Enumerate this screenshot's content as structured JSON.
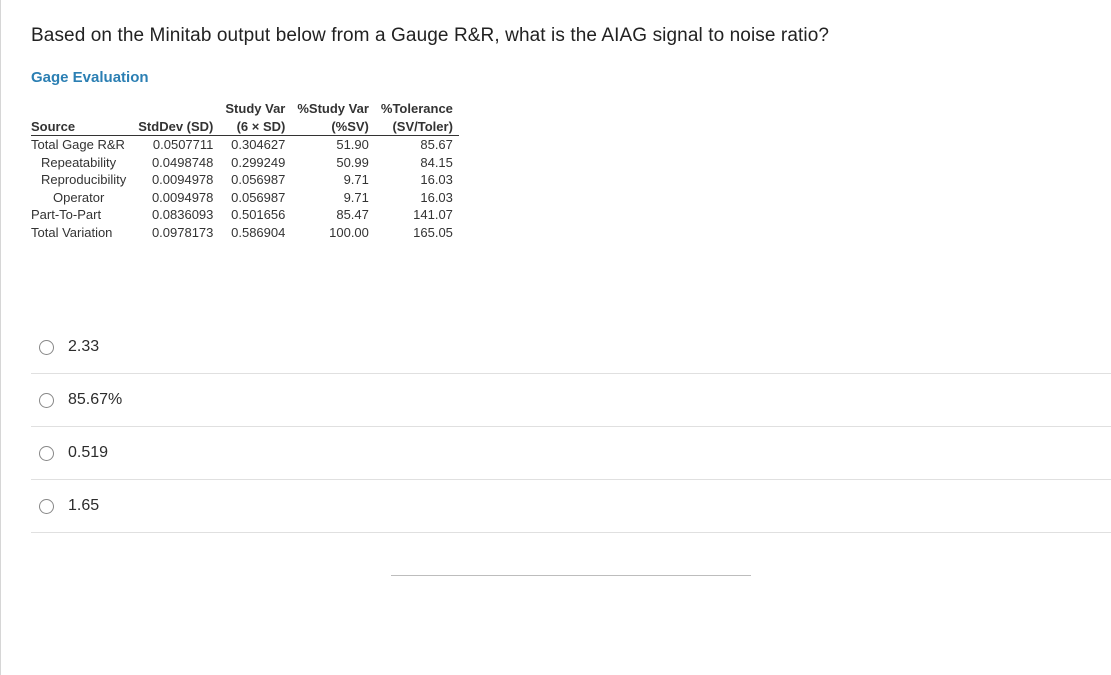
{
  "question": "Based on the Minitab output below from a Gauge R&R, what is the AIAG signal to noise ratio?",
  "section_title": "Gage Evaluation",
  "table": {
    "head_top": {
      "studyvar": "Study Var",
      "pctstudyvar": "%Study Var",
      "pcttol": "%Tolerance"
    },
    "head": {
      "source": "Source",
      "sd": "StdDev (SD)",
      "sixsd": "(6 × SD)",
      "pctsv": "(%SV)",
      "svtoler": "(SV/Toler)"
    },
    "rows": [
      {
        "indent": 0,
        "source": "Total Gage R&R",
        "sd": "0.0507711",
        "sixsd": "0.304627",
        "pctsv": "51.90",
        "svtoler": "85.67"
      },
      {
        "indent": 1,
        "source": "Repeatability",
        "sd": "0.0498748",
        "sixsd": "0.299249",
        "pctsv": "50.99",
        "svtoler": "84.15"
      },
      {
        "indent": 1,
        "source": "Reproducibility",
        "sd": "0.0094978",
        "sixsd": "0.056987",
        "pctsv": "9.71",
        "svtoler": "16.03"
      },
      {
        "indent": 2,
        "source": "Operator",
        "sd": "0.0094978",
        "sixsd": "0.056987",
        "pctsv": "9.71",
        "svtoler": "16.03"
      },
      {
        "indent": 0,
        "source": "Part-To-Part",
        "sd": "0.0836093",
        "sixsd": "0.501656",
        "pctsv": "85.47",
        "svtoler": "141.07"
      },
      {
        "indent": 0,
        "source": "Total Variation",
        "sd": "0.0978173",
        "sixsd": "0.586904",
        "pctsv": "100.00",
        "svtoler": "165.05"
      }
    ]
  },
  "choices": [
    "2.33",
    "85.67%",
    "0.519",
    "1.65"
  ]
}
